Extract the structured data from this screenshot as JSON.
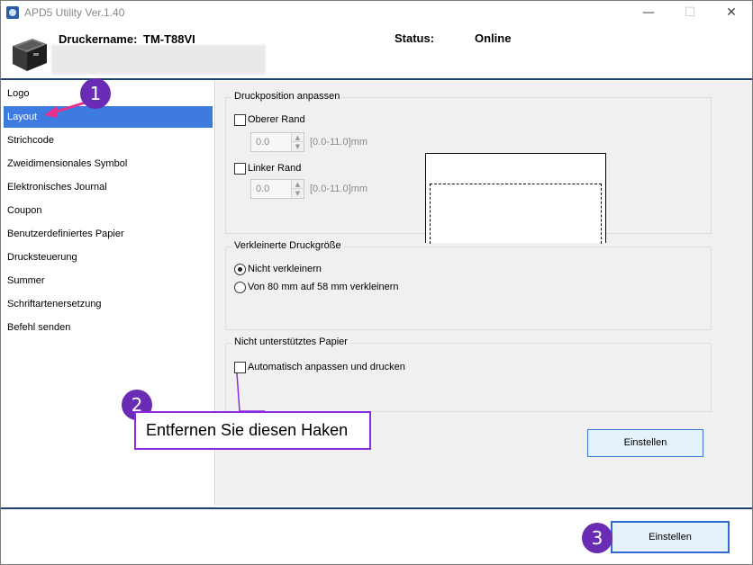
{
  "window": {
    "title": "APD5 Utility Ver.1.40",
    "minimize_glyph": "—",
    "maximize_glyph": "☐",
    "close_glyph": "✕"
  },
  "header": {
    "printer_name_label": "Druckername:",
    "printer_name_value": "TM-T88VI",
    "status_label": "Status:",
    "status_value": "Online"
  },
  "sidebar": {
    "items": [
      {
        "label": "Logo",
        "selected": false
      },
      {
        "label": "Layout",
        "selected": true
      },
      {
        "label": "Strichcode",
        "selected": false
      },
      {
        "label": "Zweidimensionales Symbol",
        "selected": false
      },
      {
        "label": "Elektronisches Journal",
        "selected": false
      },
      {
        "label": "Coupon",
        "selected": false
      },
      {
        "label": "Benutzerdefiniertes Papier",
        "selected": false
      },
      {
        "label": "Drucksteuerung",
        "selected": false
      },
      {
        "label": "Summer",
        "selected": false
      },
      {
        "label": "Schriftartenersetzung",
        "selected": false
      },
      {
        "label": "Befehl senden",
        "selected": false
      }
    ]
  },
  "print_position": {
    "title": "Druckposition anpassen",
    "top_margin": {
      "label": "Oberer Rand",
      "checked": false,
      "value": "0.0",
      "range": "[0.0-11.0]mm"
    },
    "left_margin": {
      "label": "Linker Rand",
      "checked": false,
      "value": "0.0",
      "range": "[0.0-11.0]mm"
    }
  },
  "reduce_size": {
    "title": "Verkleinerte Druckgröße",
    "options": [
      {
        "label": "Nicht verkleinern",
        "checked": true
      },
      {
        "label": "Von 80 mm auf 58 mm verkleinern",
        "checked": false
      }
    ]
  },
  "unsupported_paper": {
    "title": "Nicht unterstütztes Papier",
    "auto_fit": {
      "label": "Automatisch anpassen und drucken",
      "checked": false
    }
  },
  "buttons": {
    "apply_panel": "Einstellen",
    "apply_main": "Einstellen"
  },
  "annotations": {
    "step1": "1",
    "step2": "2",
    "step3": "3",
    "callout_text": "Entfernen Sie diesen Haken",
    "accent_color": "#6a2bb5",
    "arrow_color": "#e8308a"
  }
}
